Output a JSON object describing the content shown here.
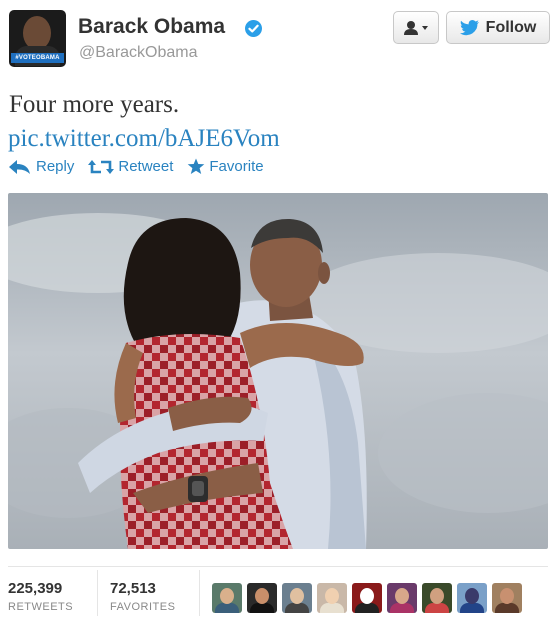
{
  "user": {
    "name": "Barack Obama",
    "handle": "@BarackObama",
    "avatar_badge": "#VOTEOBAMA",
    "verified_icon": "verified-badge-icon"
  },
  "header_buttons": {
    "user_menu_icon": "person-dropdown-icon",
    "follow_label": "Follow",
    "follow_icon": "twitter-bird-icon"
  },
  "tweet": {
    "text": "Four more years.",
    "link": "pic.twitter.com/bAJE6Vom"
  },
  "actions": [
    {
      "label": "Reply",
      "icon": "reply-arrow-icon"
    },
    {
      "label": "Retweet",
      "icon": "retweet-icon"
    },
    {
      "label": "Favorite",
      "icon": "star-icon"
    }
  ],
  "stats": {
    "retweets_count": "225,399",
    "retweets_label": "RETWEETS",
    "favorites_count": "72,513",
    "favorites_label": "FAVORITES"
  },
  "colors": {
    "link": "#2a83c0",
    "verified": "#2b9fe8",
    "text": "#333333",
    "muted": "#999999"
  },
  "favoriter_avatars": [
    {
      "bg": "#5a7a6a",
      "skin": "#d9b08c",
      "shirt": "#3b5f7a"
    },
    {
      "bg": "#2a2a2a",
      "skin": "#c98f6a",
      "shirt": "#111111"
    },
    {
      "bg": "#6b7f8f",
      "skin": "#e0c0a0",
      "shirt": "#444444"
    },
    {
      "bg": "#c9b8a8",
      "skin": "#f0d0b0",
      "shirt": "#e8e0d0"
    },
    {
      "bg": "#8a1a1a",
      "skin": "#ffffff",
      "shirt": "#222222"
    },
    {
      "bg": "#6a3a6a",
      "skin": "#d8a88a",
      "shirt": "#aa3366"
    },
    {
      "bg": "#3a4a2a",
      "skin": "#d0a080",
      "shirt": "#cc4444"
    },
    {
      "bg": "#7aa0c8",
      "skin": "#3a3a6a",
      "shirt": "#224488"
    },
    {
      "bg": "#a08060",
      "skin": "#c89070",
      "shirt": "#5a3a2a"
    }
  ]
}
